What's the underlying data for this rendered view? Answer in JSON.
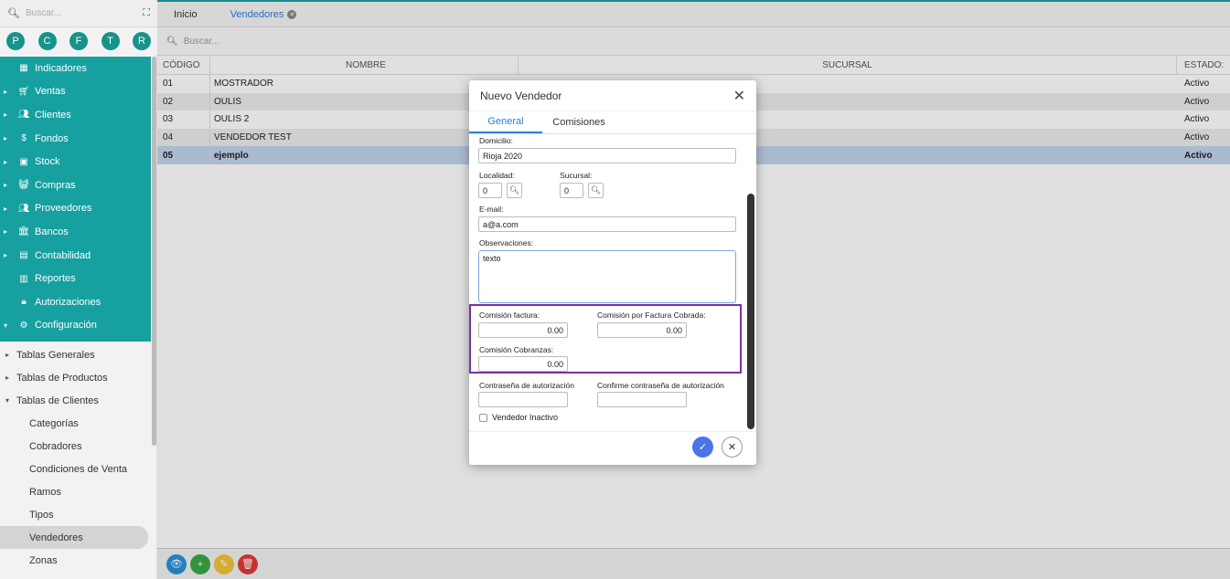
{
  "sidebar": {
    "search_placeholder": "Buscar...",
    "quick_buttons": [
      "P",
      "C",
      "F",
      "T",
      "R"
    ],
    "teal_items": [
      {
        "label": "Indicadores",
        "icon": "dashboard-icon",
        "caret": ""
      },
      {
        "label": "Ventas",
        "icon": "cart-icon",
        "caret": "▸"
      },
      {
        "label": "Clientes",
        "icon": "people-icon",
        "caret": "▸"
      },
      {
        "label": "Fondos",
        "icon": "dollar-icon",
        "caret": "▸"
      },
      {
        "label": "Stock",
        "icon": "box-icon",
        "caret": "▸"
      },
      {
        "label": "Compras",
        "icon": "basket-icon",
        "caret": "▸"
      },
      {
        "label": "Proveedores",
        "icon": "people-icon",
        "caret": "▸"
      },
      {
        "label": "Bancos",
        "icon": "bank-icon",
        "caret": "▸"
      },
      {
        "label": "Contabilidad",
        "icon": "ledger-icon",
        "caret": "▸"
      },
      {
        "label": "Reportes",
        "icon": "report-icon",
        "caret": ""
      },
      {
        "label": "Autorizaciones",
        "icon": "lock-icon",
        "caret": ""
      },
      {
        "label": "Configuración",
        "icon": "gears-icon",
        "caret": "▾"
      }
    ],
    "groups": [
      {
        "label": "Tablas Generales",
        "caret": "▸"
      },
      {
        "label": "Tablas de Productos",
        "caret": "▸"
      },
      {
        "label": "Tablas de Clientes",
        "caret": "▾"
      }
    ],
    "sub_items": [
      "Categorías",
      "Cobradores",
      "Condiciones de Venta",
      "Ramos",
      "Tipos",
      "Vendedores",
      "Zonas"
    ]
  },
  "tabs": {
    "home": "Inicio",
    "active": "Vendedores"
  },
  "main": {
    "search_placeholder": "Buscar..."
  },
  "table": {
    "headers": [
      "CÓDIGO",
      "NOMBRE",
      "SUCURSAL",
      "ESTADO:"
    ],
    "rows": [
      [
        "01",
        "MOSTRADOR",
        "",
        "Activo"
      ],
      [
        "02",
        "OULIS",
        "",
        "Activo"
      ],
      [
        "03",
        "OULIS 2",
        "",
        "Activo"
      ],
      [
        "04",
        "VENDEDOR TEST",
        "",
        "Activo"
      ],
      [
        "05",
        "ejemplo",
        "",
        "Activo"
      ]
    ]
  },
  "modal": {
    "title": "Nuevo Vendedor",
    "tab_general": "General",
    "tab_comisiones": "Comisiones",
    "domicilio_label": "Domicilio:",
    "domicilio_value": "Rioja 2020",
    "localidad_label": "Localidad:",
    "localidad_value": "0",
    "sucursal_label": "Sucursal:",
    "sucursal_value": "0",
    "email_label": "E-mail:",
    "email_value": "a@a.com",
    "obs_label": "Observaciones:",
    "obs_value": "texto",
    "com_factura_label": "Comisión factura:",
    "com_factura_value": "0.00",
    "com_cobrada_label": "Comisión por Factura Cobrada:",
    "com_cobrada_value": "0.00",
    "com_cobranzas_label": "Comisión Cobranzas:",
    "com_cobranzas_value": "0.00",
    "pwd_label": "Contraseña de autorización",
    "pwd_confirm_label": "Confirme contraseña de autorización",
    "inactive_label": "Vendedor Inactivo"
  },
  "colors": {
    "teal": "#16a0a0",
    "accent": "#2b7fd9",
    "highlight": "#7b2fa8"
  }
}
